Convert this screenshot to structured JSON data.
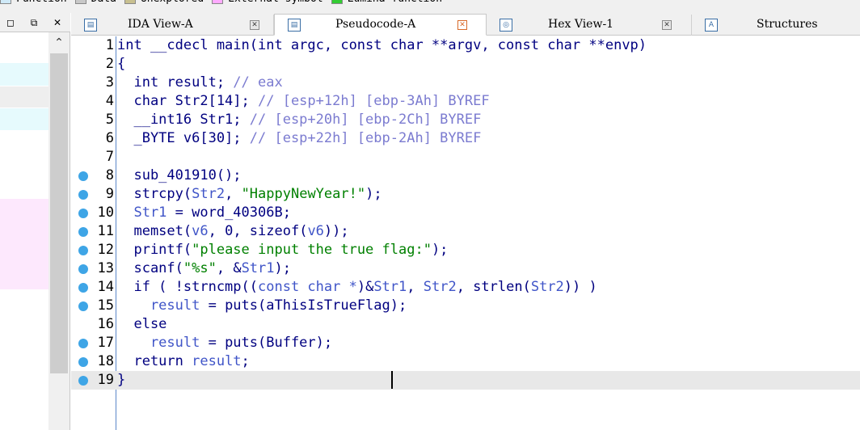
{
  "legend": [
    {
      "label": "Function",
      "color": "#cfe9f7"
    },
    {
      "label": "Data",
      "color": "#c8c8c8"
    },
    {
      "label": "Unexplored",
      "color": "#c8c090"
    },
    {
      "label": "External symbol",
      "color": "#ffaaff"
    },
    {
      "label": "Lumina function",
      "color": "#33cc33"
    }
  ],
  "left_panel": {
    "restore": "◻",
    "float": "⧉",
    "close": "✕",
    "scroll_up": "⌃"
  },
  "tabs": [
    {
      "label": "IDA View-A",
      "icon": "ida-view-icon",
      "close": "✕",
      "active": false
    },
    {
      "label": "Pseudocode-A",
      "icon": "pseudocode-icon",
      "close": "✕",
      "active": true
    },
    {
      "label": "Hex View-1",
      "icon": "hex-view-icon",
      "close": "✕",
      "active": false
    },
    {
      "label": "Structures",
      "icon": "structures-icon",
      "close": "",
      "active": false
    }
  ],
  "code": {
    "lines": [
      {
        "num": "1",
        "dot": false,
        "segs": [
          [
            "kw",
            "int __cdecl main(int argc, const char **argv, const char **envp)"
          ]
        ]
      },
      {
        "num": "2",
        "dot": false,
        "segs": [
          [
            "op",
            "{"
          ]
        ]
      },
      {
        "num": "3",
        "dot": false,
        "segs": [
          [
            "kw",
            "  int result; "
          ],
          [
            "cmt",
            "// eax"
          ]
        ]
      },
      {
        "num": "4",
        "dot": false,
        "segs": [
          [
            "kw",
            "  char Str2[14]; "
          ],
          [
            "cmt",
            "// [esp+12h] [ebp-3Ah] BYREF"
          ]
        ]
      },
      {
        "num": "5",
        "dot": false,
        "segs": [
          [
            "kw",
            "  __int16 Str1; "
          ],
          [
            "cmt",
            "// [esp+20h] [ebp-2Ch] BYREF"
          ]
        ]
      },
      {
        "num": "6",
        "dot": false,
        "segs": [
          [
            "kw",
            "  _BYTE v6[30]; "
          ],
          [
            "cmt",
            "// [esp+22h] [ebp-2Ah] BYREF"
          ]
        ]
      },
      {
        "num": "7",
        "dot": false,
        "segs": []
      },
      {
        "num": "8",
        "dot": true,
        "segs": [
          [
            "fn",
            "  sub_401910();"
          ]
        ]
      },
      {
        "num": "9",
        "dot": true,
        "segs": [
          [
            "fn",
            "  strcpy("
          ],
          [
            "var",
            "Str2"
          ],
          [
            "fn",
            ", "
          ],
          [
            "str",
            "\"HappyNewYear!\""
          ],
          [
            "fn",
            ");"
          ]
        ]
      },
      {
        "num": "10",
        "dot": true,
        "segs": [
          [
            "var",
            "  Str1"
          ],
          [
            "fn",
            " = word_40306B;"
          ]
        ]
      },
      {
        "num": "11",
        "dot": true,
        "segs": [
          [
            "fn",
            "  memset("
          ],
          [
            "var",
            "v6"
          ],
          [
            "fn",
            ", 0, sizeof("
          ],
          [
            "var",
            "v6"
          ],
          [
            "fn",
            "));"
          ]
        ]
      },
      {
        "num": "12",
        "dot": true,
        "segs": [
          [
            "fn",
            "  printf("
          ],
          [
            "str",
            "\"please input the true flag:\""
          ],
          [
            "fn",
            ");"
          ]
        ]
      },
      {
        "num": "13",
        "dot": true,
        "segs": [
          [
            "fn",
            "  scanf("
          ],
          [
            "str",
            "\"%s\""
          ],
          [
            "fn",
            ", &"
          ],
          [
            "var",
            "Str1"
          ],
          [
            "fn",
            ");"
          ]
        ]
      },
      {
        "num": "14",
        "dot": true,
        "segs": [
          [
            "fn",
            "  if ( !strncmp(("
          ],
          [
            "var",
            "const char *"
          ],
          [
            "fn",
            ")&"
          ],
          [
            "var",
            "Str1"
          ],
          [
            "fn",
            ", "
          ],
          [
            "var",
            "Str2"
          ],
          [
            "fn",
            ", strlen("
          ],
          [
            "var",
            "Str2"
          ],
          [
            "fn",
            ")) )"
          ]
        ]
      },
      {
        "num": "15",
        "dot": true,
        "segs": [
          [
            "var",
            "    result"
          ],
          [
            "fn",
            " = puts(aThisIsTrueFlag);"
          ]
        ]
      },
      {
        "num": "16",
        "dot": false,
        "segs": [
          [
            "fn",
            "  else"
          ]
        ]
      },
      {
        "num": "17",
        "dot": true,
        "segs": [
          [
            "var",
            "    result"
          ],
          [
            "fn",
            " = puts(Buffer);"
          ]
        ]
      },
      {
        "num": "18",
        "dot": true,
        "segs": [
          [
            "fn",
            "  return "
          ],
          [
            "var",
            "result"
          ],
          [
            "fn",
            ";"
          ]
        ]
      },
      {
        "num": "19",
        "dot": true,
        "segs": [
          [
            "op",
            "}"
          ]
        ]
      }
    ]
  }
}
